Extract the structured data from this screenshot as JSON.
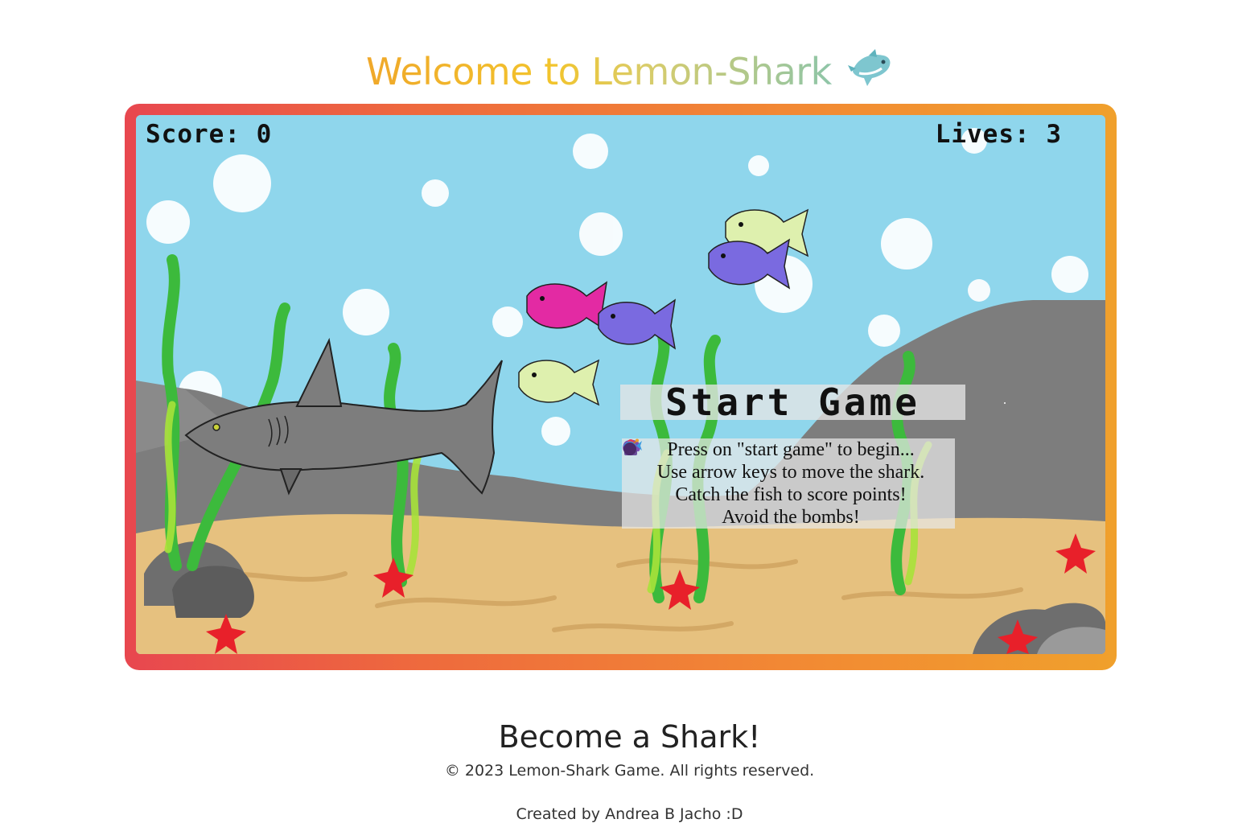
{
  "header": {
    "title": "Welcome to Lemon-Shark",
    "icon": "dolphin-icon"
  },
  "game": {
    "hud": {
      "score_label": "Score:",
      "score_value": "0",
      "lives_label": "Lives:",
      "lives_value": "3"
    },
    "start_button_label": "Start Game",
    "instructions": [
      {
        "icon": "gamepad-icon",
        "text": "Press on \"start game\" to begin..."
      },
      {
        "icon": "joystick-icon",
        "text": "Use arrow keys to move the shark."
      },
      {
        "icon": "fish-icon",
        "text": "Catch the fish to score points!"
      },
      {
        "icon": "bomb-icon",
        "text": "Avoid the bombs!"
      }
    ],
    "colors": {
      "water": "#8fd6ec",
      "sand": "#e6c17f",
      "rock": "#7d7d7d",
      "seaweed": "#3cba3c",
      "starfish": "#e8202a",
      "frame_start": "#e8474f",
      "frame_end": "#f0a02c"
    }
  },
  "footer": {
    "subtitle": "Become a Shark!",
    "copyright": "© 2023 Lemon-Shark Game. All rights reserved.",
    "credit": "Created by Andrea B Jacho :D"
  }
}
